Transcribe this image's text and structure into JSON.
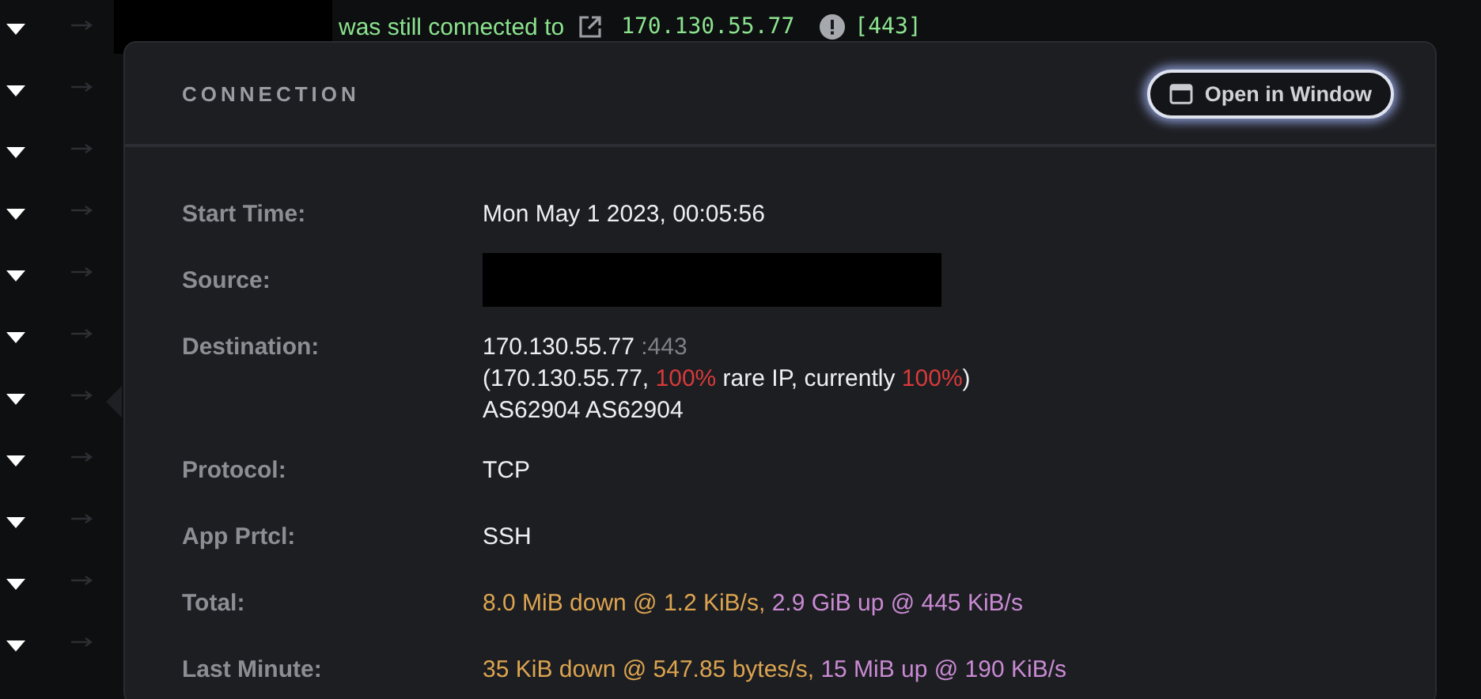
{
  "event_line": {
    "message": "was still connected to",
    "address": "170.130.55.77",
    "port": "[443]"
  },
  "panel": {
    "title": "CONNECTION",
    "open_button": "Open in Window",
    "fields": [
      {
        "label": "Start Time:",
        "kind": "text",
        "lines": [
          [
            {
              "text": "Mon May 1 2023, 00:05:56",
              "kind": "plain"
            }
          ]
        ]
      },
      {
        "label": "Source:",
        "kind": "redacted"
      },
      {
        "label": "Destination:",
        "kind": "text",
        "lines": [
          [
            {
              "text": "170.130.55.77",
              "kind": "plain"
            },
            {
              "text": " :443",
              "kind": "muted"
            }
          ],
          [
            {
              "text": "(170.130.55.77, ",
              "kind": "plain"
            },
            {
              "text": "100%",
              "kind": "alert"
            },
            {
              "text": " rare IP, currently ",
              "kind": "plain"
            },
            {
              "text": "100%",
              "kind": "alert"
            },
            {
              "text": ")",
              "kind": "plain"
            }
          ],
          [
            {
              "text": "AS62904 AS62904",
              "kind": "plain"
            }
          ]
        ]
      },
      {
        "label": "Protocol:",
        "kind": "text",
        "lines": [
          [
            {
              "text": "TCP",
              "kind": "plain"
            }
          ]
        ]
      },
      {
        "label": "App Prtcl:",
        "kind": "text",
        "lines": [
          [
            {
              "text": "SSH",
              "kind": "plain"
            }
          ]
        ]
      },
      {
        "label": "Total:",
        "kind": "text",
        "lines": [
          [
            {
              "text": "8.0 MiB down @ 1.2 KiB/s, ",
              "kind": "down"
            },
            {
              "text": "2.9 GiB up @ 445 KiB/s",
              "kind": "up"
            }
          ]
        ]
      },
      {
        "label": "Last Minute:",
        "kind": "text",
        "lines": [
          [
            {
              "text": "35 KiB down @ 547.85 bytes/s, ",
              "kind": "down"
            },
            {
              "text": "15 MiB up @ 190 KiB/s",
              "kind": "up"
            }
          ]
        ]
      }
    ]
  }
}
